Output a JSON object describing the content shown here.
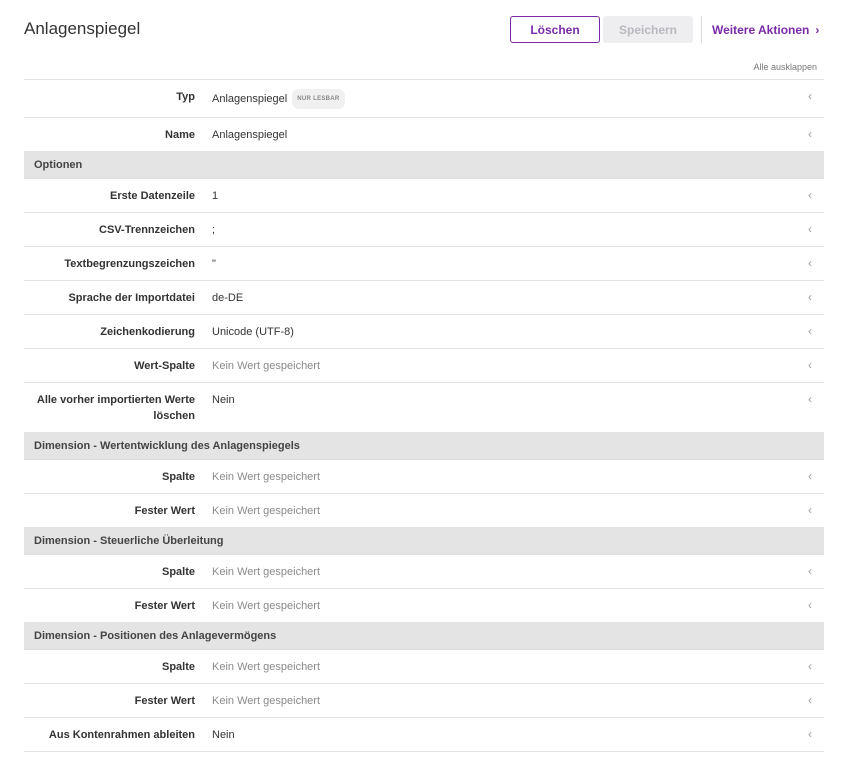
{
  "header": {
    "title": "Anlagenspiegel",
    "delete_label": "Löschen",
    "save_label": "Speichern",
    "more_actions_label": "Weitere Aktionen",
    "expand_all_label": "Alle ausklappen"
  },
  "colors": {
    "accent": "#7a2aa8",
    "section_bg": "#e4e4e4",
    "disabled_button_bg": "#eeeef0"
  },
  "rows": {
    "typ": {
      "label": "Typ",
      "value": "Anlagenspiegel",
      "badge": "NUR LESBAR"
    },
    "name": {
      "label": "Name",
      "value": "Anlagenspiegel"
    }
  },
  "sections": {
    "optionen": {
      "title": "Optionen",
      "rows": [
        {
          "label": "Erste Datenzeile",
          "value": "1"
        },
        {
          "label": "CSV-Trennzeichen",
          "value": ";"
        },
        {
          "label": "Textbegrenzungszeichen",
          "value": "\""
        },
        {
          "label": "Sprache der Importdatei",
          "value": "de-DE"
        },
        {
          "label": "Zeichenkodierung",
          "value": "Unicode (UTF-8)"
        },
        {
          "label": "Wert-Spalte",
          "value": "Kein Wert gespeichert"
        },
        {
          "label": "Alle vorher importierten Werte löschen",
          "value": "Nein"
        }
      ]
    },
    "wertentwicklung": {
      "title": "Dimension - Wertentwicklung des Anlagenspiegels",
      "rows": [
        {
          "label": "Spalte",
          "value": "Kein Wert gespeichert"
        },
        {
          "label": "Fester Wert",
          "value": "Kein Wert gespeichert"
        }
      ]
    },
    "steuerlich": {
      "title": "Dimension - Steuerliche Überleitung",
      "rows": [
        {
          "label": "Spalte",
          "value": "Kein Wert gespeichert"
        },
        {
          "label": "Fester Wert",
          "value": "Kein Wert gespeichert"
        }
      ]
    },
    "positionen": {
      "title": "Dimension - Positionen des Anlagevermögens",
      "rows": [
        {
          "label": "Spalte",
          "value": "Kein Wert gespeichert"
        },
        {
          "label": "Fester Wert",
          "value": "Kein Wert gespeichert"
        },
        {
          "label": "Aus Kontenrahmen ableiten",
          "value": "Nein"
        }
      ]
    }
  },
  "icons": {
    "row_chevron": "chevron-left-icon",
    "more_chevron": "chevron-right-icon"
  }
}
